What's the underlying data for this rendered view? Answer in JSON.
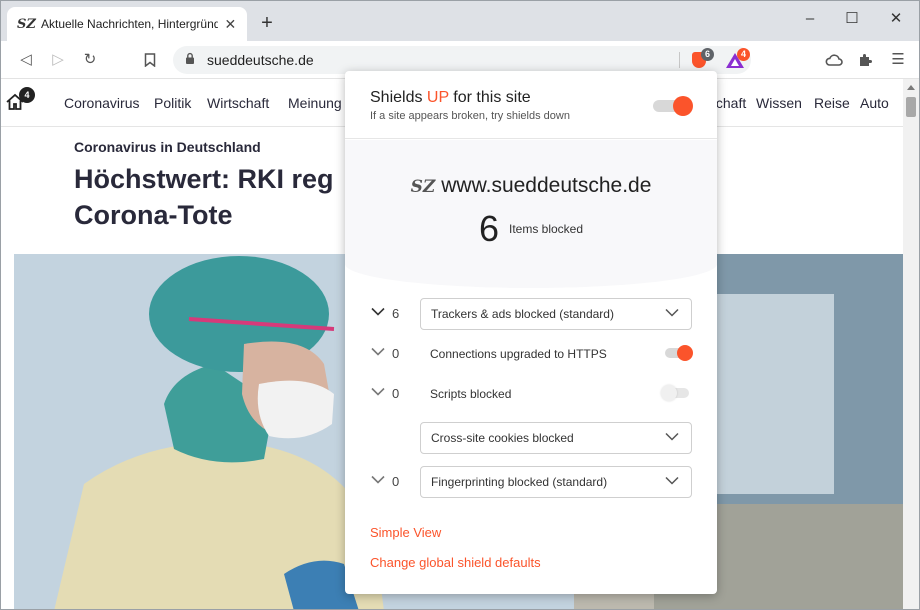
{
  "browser": {
    "tab": {
      "favicon": "SZ",
      "title": "Aktuelle Nachrichten, Hintergründe"
    },
    "window_controls": {
      "minimize": "–",
      "maximize": "☐",
      "close": "✕"
    },
    "address_bar": {
      "url": "sueddeutsche.de"
    },
    "shields_badge": "6",
    "rewards_badge": "4",
    "colors": {
      "accent": "#fb542b",
      "rewards": "#8b2fd1"
    }
  },
  "site": {
    "nav_badge": "4",
    "nav": [
      "Coronavirus",
      "Politik",
      "Wirtschaft",
      "Meinung",
      "Wirtschaft",
      "Wissen",
      "Reise",
      "Auto"
    ],
    "kicker": "Coronavirus in Deutschland",
    "headline": "Höchstwert: RKI reg\nCorona-Tote"
  },
  "shields_popup": {
    "title_prefix": "Shields ",
    "title_state": "UP",
    "title_suffix": " for this site",
    "subtitle": "If a site appears broken, try shields down",
    "main_toggle_on": true,
    "site_logo": "SZ",
    "site_host": "www.sueddeutsche.de",
    "items_blocked_count": "6",
    "items_blocked_label": "Items blocked",
    "controls": {
      "trackers": {
        "count": "6",
        "label": "Trackers & ads blocked (standard)"
      },
      "https": {
        "count": "0",
        "label": "Connections upgraded to HTTPS",
        "enabled": true
      },
      "scripts": {
        "count": "0",
        "label": "Scripts blocked",
        "enabled": false
      },
      "cookies": {
        "label": "Cross-site cookies blocked"
      },
      "fingerprinting": {
        "count": "0",
        "label": "Fingerprinting blocked (standard)"
      }
    },
    "simple_view": "Simple View",
    "global_defaults": "Change global shield defaults"
  }
}
